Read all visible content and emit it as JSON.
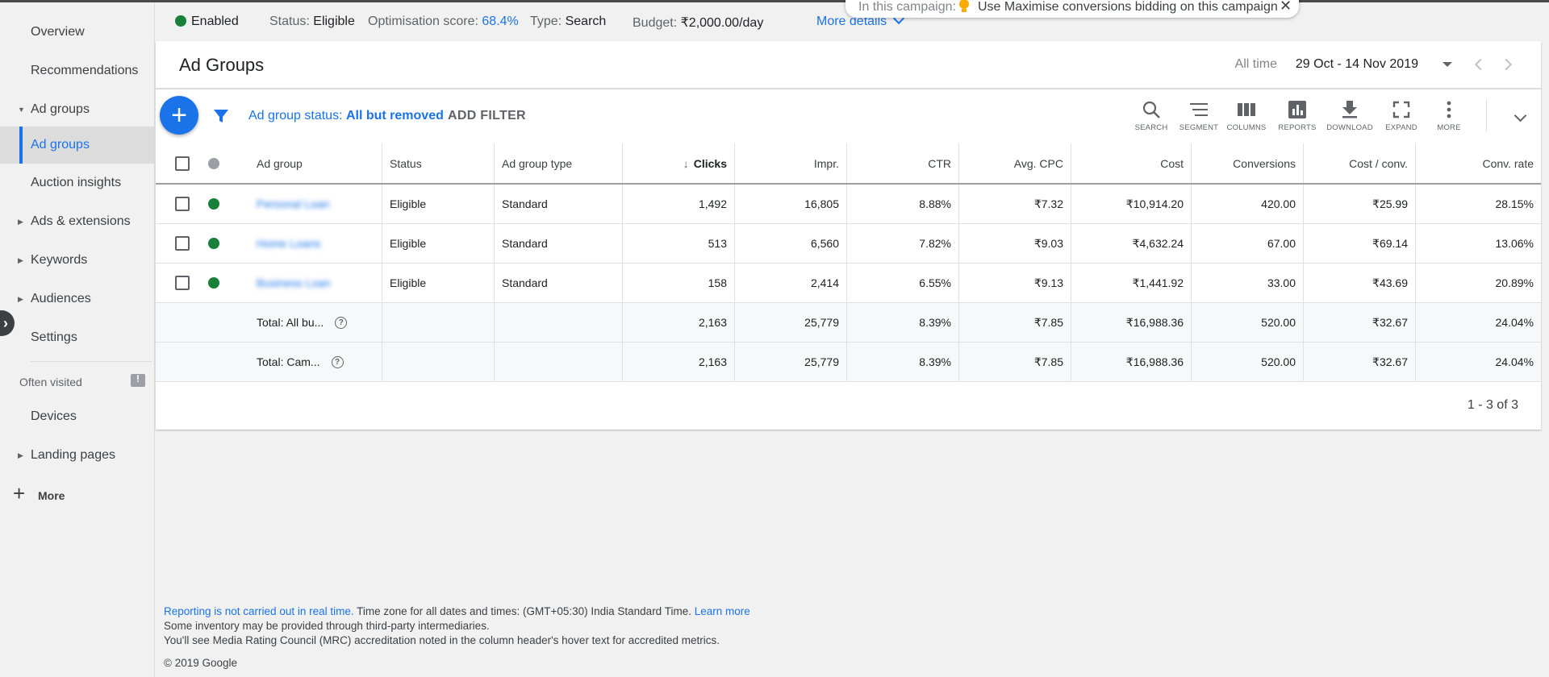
{
  "summary": {
    "status_enabled": "Enabled",
    "status_label": "Status:",
    "status_value": "Eligible",
    "opt_label": "Optimisation score:",
    "opt_value": "68.4%",
    "type_label": "Type:",
    "type_value": "Search",
    "budget_label": "Budget:",
    "budget_value": "₹2,000.00/day",
    "more_details": "More details"
  },
  "tip": {
    "prefix": "In this campaign:",
    "text": "Use Maximise conversions bidding on this campaign"
  },
  "sidebar": {
    "items": [
      {
        "label": "Overview"
      },
      {
        "label": "Recommendations"
      },
      {
        "label": "Ad groups"
      },
      {
        "label": "Ad groups"
      },
      {
        "label": "Auction insights"
      },
      {
        "label": "Ads & extensions"
      },
      {
        "label": "Keywords"
      },
      {
        "label": "Audiences"
      },
      {
        "label": "Settings"
      }
    ],
    "often_visited": "Often visited",
    "often_items": [
      {
        "label": "Devices"
      },
      {
        "label": "Landing pages"
      }
    ],
    "more": "More"
  },
  "page": {
    "title": "Ad Groups",
    "date_all_time": "All time",
    "date_range": "29 Oct - 14 Nov 2019"
  },
  "toolbar": {
    "filter_label": "Ad group status:",
    "filter_value": "All but removed",
    "add_filter": "ADD FILTER",
    "tools": [
      "SEARCH",
      "SEGMENT",
      "COLUMNS",
      "REPORTS",
      "DOWNLOAD",
      "EXPAND",
      "MORE"
    ]
  },
  "table": {
    "headers": [
      "Ad group",
      "Status",
      "Ad group type",
      "Clicks",
      "Impr.",
      "CTR",
      "Avg. CPC",
      "Cost",
      "Conversions",
      "Cost / conv.",
      "Conv. rate"
    ],
    "rows": [
      [
        "Personal Loan",
        "Eligible",
        "Standard",
        "1,492",
        "16,805",
        "8.88%",
        "₹7.32",
        "₹10,914.20",
        "420.00",
        "₹25.99",
        "28.15%"
      ],
      [
        "Home Loans",
        "Eligible",
        "Standard",
        "513",
        "6,560",
        "7.82%",
        "₹9.03",
        "₹4,632.24",
        "67.00",
        "₹69.14",
        "13.06%"
      ],
      [
        "Business Loan",
        "Eligible",
        "Standard",
        "158",
        "2,414",
        "6.55%",
        "₹9.13",
        "₹1,441.92",
        "33.00",
        "₹43.69",
        "20.89%"
      ]
    ],
    "totals": [
      [
        "Total: All bu...",
        "",
        "",
        "2,163",
        "25,779",
        "8.39%",
        "₹7.85",
        "₹16,988.36",
        "520.00",
        "₹32.67",
        "24.04%"
      ],
      [
        "Total: Cam...",
        "",
        "",
        "2,163",
        "25,779",
        "8.39%",
        "₹7.85",
        "₹16,988.36",
        "520.00",
        "₹32.67",
        "24.04%"
      ]
    ],
    "pager": "1 - 3 of 3"
  },
  "footer": {
    "line1_link": "Reporting is not carried out in real time.",
    "line1_text": " Time zone for all dates and times: (GMT+05:30) India Standard Time. ",
    "line1_learn": "Learn more",
    "line2": "Some inventory may be provided through third-party intermediaries.",
    "line3": "You'll see Media Rating Council (MRC) accreditation noted in the column header's hover text for accredited metrics.",
    "copyright": "© 2019 Google"
  },
  "colors": {
    "accent": "#1a73e8",
    "enabled": "#188038",
    "bulb": "#f9ab00"
  }
}
